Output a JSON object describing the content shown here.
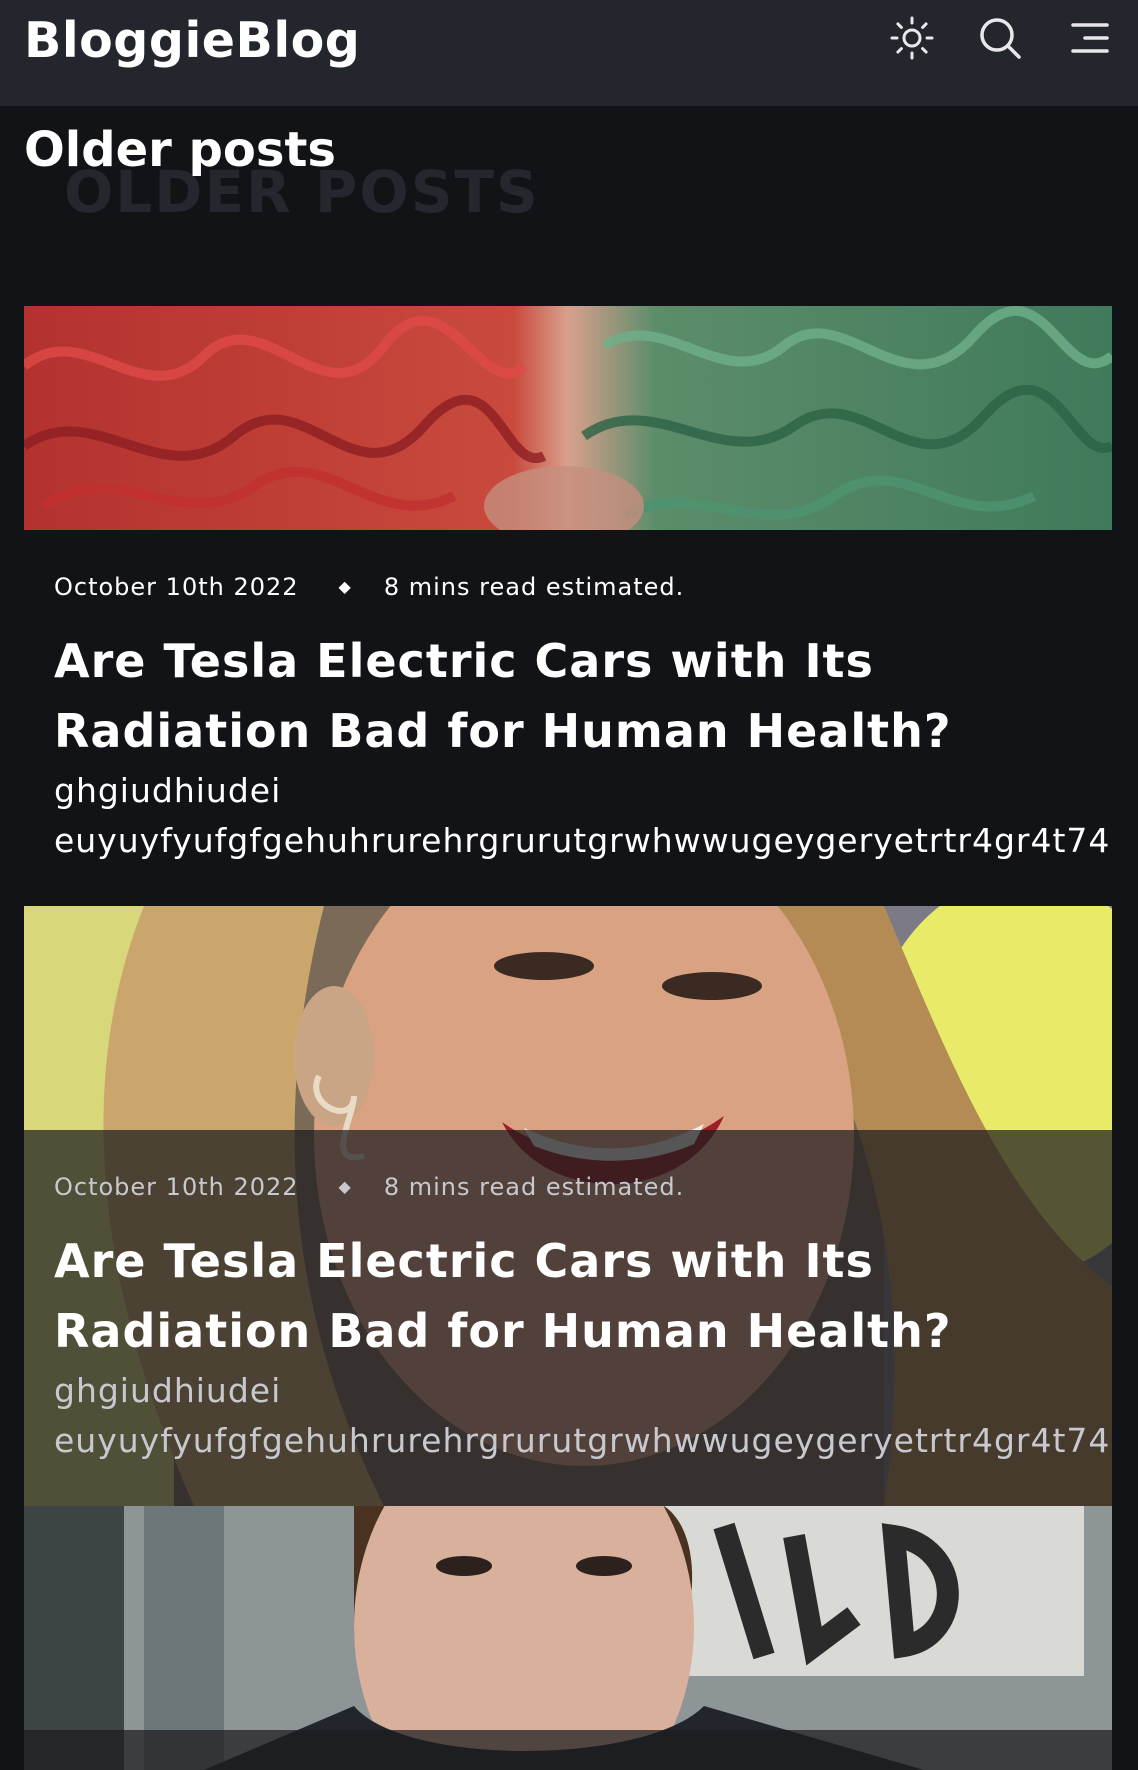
{
  "header": {
    "brand": "BloggieBlog",
    "icons": [
      "sun-icon",
      "search-icon",
      "menu-icon"
    ]
  },
  "page": {
    "title": "Older posts",
    "ghost_title": "OLDER POSTS"
  },
  "posts": [
    {
      "date": "October 10th 2022",
      "separator": "◆",
      "read_time": "8 mins read estimated.",
      "title": "Are Tesla Electric Cars with Its Radiation Bad for Human Health?",
      "excerpt": "ghgiudhiudei\neuyuyfyufgfgehuhrurehrgrurutgrwhwwugeygeryetrtr4gr4t74"
    },
    {
      "date": "October 10th 2022",
      "separator": "◆",
      "read_time": "8 mins read estimated.",
      "title": "Are Tesla Electric Cars with Its Radiation Bad for Human Health?",
      "excerpt": "ghgiudhiudei\neuyuyfyufgfgehuhrurehrgrurutgrwhwwugeygeryetrtr4gr4t74"
    }
  ],
  "colors": {
    "header_bg": "#23262d",
    "page_bg": "#121317",
    "text": "#ffffff"
  }
}
